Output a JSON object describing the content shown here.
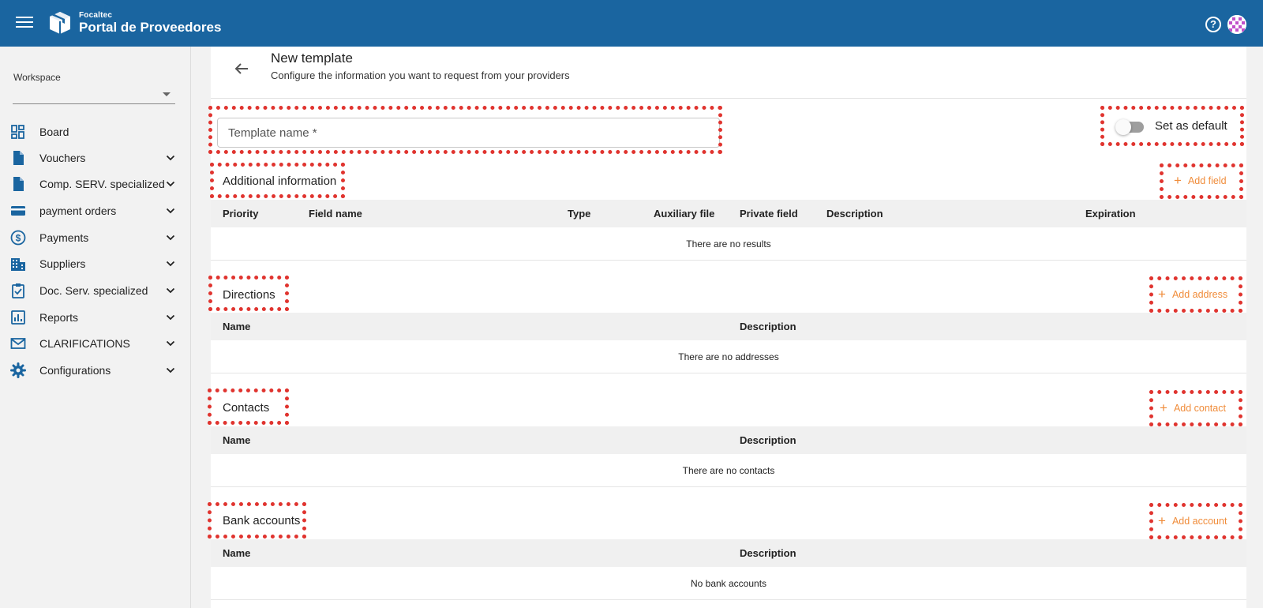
{
  "header": {
    "brand_small": "Focaltec",
    "brand_big": "Portal de Proveedores",
    "help_symbol": "?"
  },
  "sidebar": {
    "workspace_label": "Workspace",
    "workspace_value": "",
    "items": [
      {
        "label": "Board",
        "icon": "dashboard-icon",
        "expandable": false
      },
      {
        "label": "Vouchers",
        "icon": "document-icon",
        "expandable": true
      },
      {
        "label": "Comp. SERV. specialized",
        "icon": "document-icon",
        "expandable": true
      },
      {
        "label": "payment orders",
        "icon": "credit-card-icon",
        "expandable": true
      },
      {
        "label": "Payments",
        "icon": "dollar-circle-icon",
        "expandable": true
      },
      {
        "label": "Suppliers",
        "icon": "building-icon",
        "expandable": true
      },
      {
        "label": "Doc. Serv. specialized",
        "icon": "clipboard-check-icon",
        "expandable": true
      },
      {
        "label": "Reports",
        "icon": "bar-chart-icon",
        "expandable": true
      },
      {
        "label": "CLARIFICATIONS",
        "icon": "mail-icon",
        "expandable": true
      },
      {
        "label": "Configurations",
        "icon": "gear-icon",
        "expandable": true
      }
    ]
  },
  "page": {
    "title": "New template",
    "subtitle": "Configure the information you want to request from your providers",
    "template_name_placeholder": "Template name *",
    "set_default_label": "Set as default"
  },
  "additional_info": {
    "title": "Additional information",
    "add_label": "Add field",
    "columns": [
      "Priority",
      "Field name",
      "Type",
      "Auxiliary file",
      "Private field",
      "Description",
      "Expiration"
    ],
    "empty": "There are no results"
  },
  "directions": {
    "title": "Directions",
    "add_label": "Add address",
    "columns": [
      "Name",
      "Description"
    ],
    "empty": "There are no addresses"
  },
  "contacts": {
    "title": "Contacts",
    "add_label": "Add contact",
    "columns": [
      "Name",
      "Description"
    ],
    "empty": "There are no contacts"
  },
  "bank_accounts": {
    "title": "Bank accounts",
    "add_label": "Add account",
    "columns": [
      "Name",
      "Description"
    ],
    "empty": "No bank accounts"
  },
  "colors": {
    "topbar": "#1a65a0",
    "accent": "#f08c3a",
    "highlight": "#e0342f",
    "icon_blue": "#1a65a0"
  }
}
